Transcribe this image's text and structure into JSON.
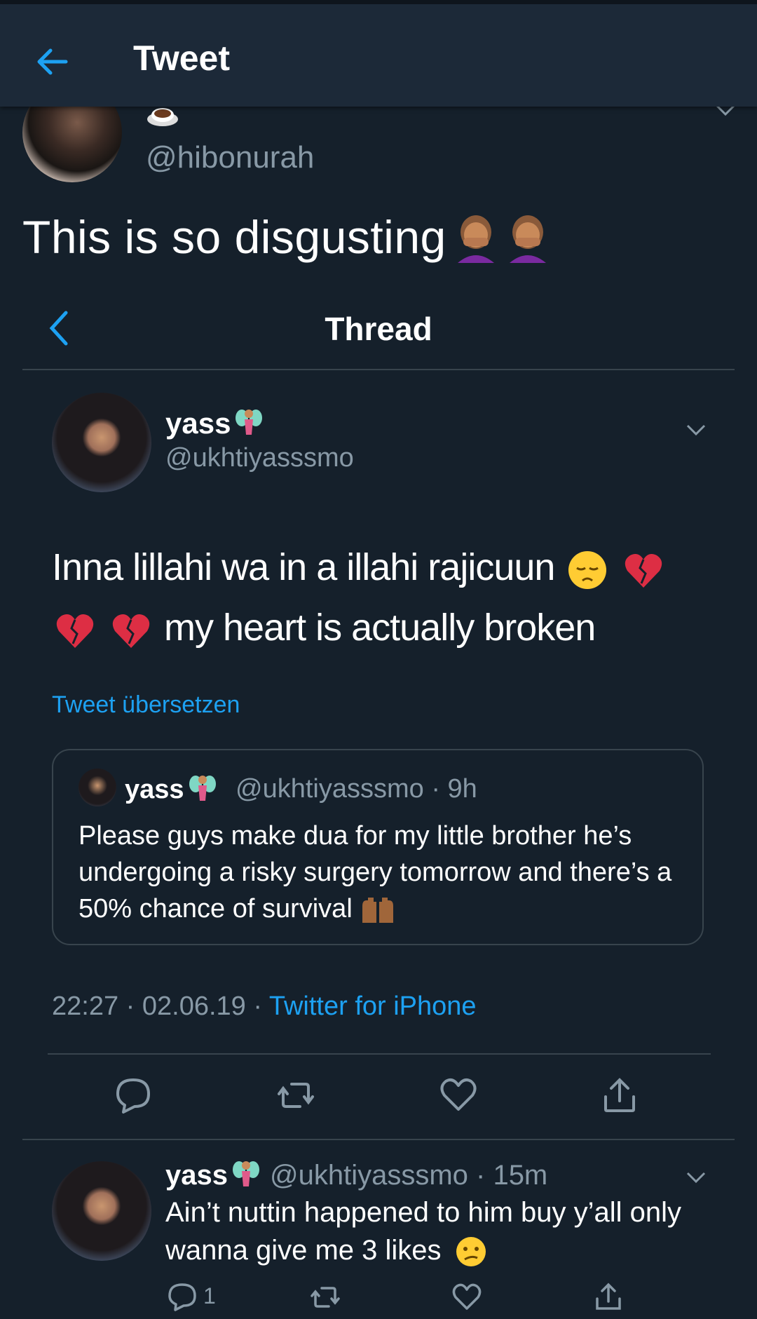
{
  "header": {
    "title": "Tweet",
    "back_icon": "arrow-left-icon"
  },
  "outer_tweet": {
    "display_emoji": "coffee-cup-icon",
    "handle": "@hibonurah",
    "text": "This is so disgusting",
    "emojis": [
      "face-palm-icon",
      "face-palm-icon"
    ]
  },
  "thread": {
    "title": "Thread",
    "main": {
      "name": "yass",
      "handle": "@ukhtiyasssmo",
      "text_line1": "Inna lillahi wa in a illahi rajicuun",
      "text_line2": "my heart is actually broken",
      "translate": "Tweet übersetzen",
      "quote": {
        "name": "yass",
        "handle_time": "@ukhtiyasssmo · 9h",
        "text": "Please guys make dua for my little brother he’s undergoing a risky surgery tomorrow and there’s a 50% chance of survival"
      },
      "meta_time": "22:27 · 02.06.19 · ",
      "meta_source": "Twitter for iPhone"
    },
    "reply": {
      "name": "yass",
      "handle_time": "@ukhtiyasssmo · 15m",
      "text": "Ain’t nuttin happened to him buy y’all only wanna give me 3 likes",
      "reply_count": "1"
    }
  },
  "colors": {
    "background": "#15202b",
    "header": "#1c2938",
    "accent": "#1da1f2",
    "muted": "#8899a6",
    "divider": "#38444d"
  }
}
